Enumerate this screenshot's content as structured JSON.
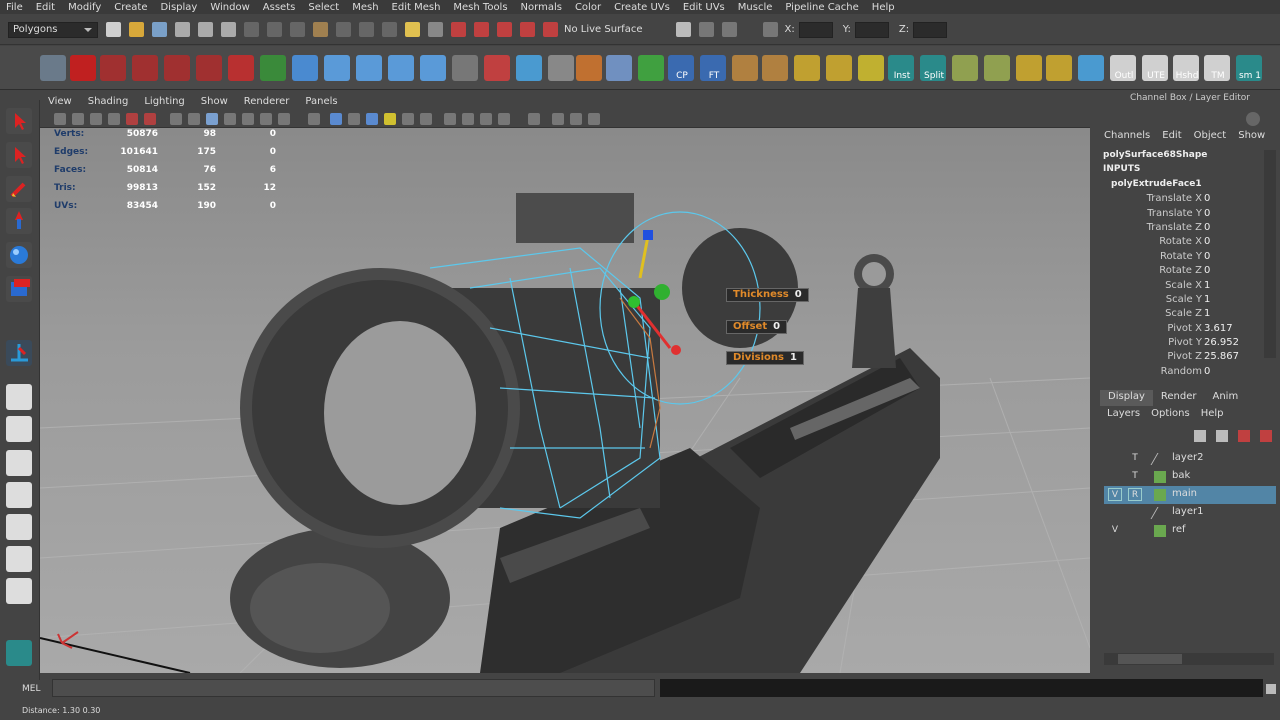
{
  "menubar": [
    "File",
    "Edit",
    "Modify",
    "Create",
    "Display",
    "Window",
    "Assets",
    "Select",
    "Mesh",
    "Edit Mesh",
    "Mesh Tools",
    "Normals",
    "Color",
    "Create UVs",
    "Edit UVs",
    "Muscle",
    "Pipeline Cache",
    "Help"
  ],
  "status": {
    "mode": "Polygons",
    "live_surface": "No Live Surface",
    "x_label": "X:",
    "y_label": "Y:",
    "z_label": "Z:"
  },
  "shelf": {
    "labels": [
      "CP",
      "FT",
      "Inst",
      "Split",
      "Outl",
      "UTE",
      "Hshd",
      "TM",
      "sm 1"
    ]
  },
  "panel_menu": [
    "View",
    "Shading",
    "Lighting",
    "Show",
    "Renderer",
    "Panels"
  ],
  "hud": {
    "rows": [
      {
        "label": "Verts:",
        "a": "50876",
        "b": "98",
        "c": "0"
      },
      {
        "label": "Edges:",
        "a": "101641",
        "b": "175",
        "c": "0"
      },
      {
        "label": "Faces:",
        "a": "50814",
        "b": "76",
        "c": "6"
      },
      {
        "label": "Tris:",
        "a": "99813",
        "b": "152",
        "c": "12"
      },
      {
        "label": "UVs:",
        "a": "83454",
        "b": "190",
        "c": "0"
      }
    ]
  },
  "extrude_hud": {
    "thickness_label": "Thickness",
    "thickness_value": "0",
    "offset_label": "Offset",
    "offset_value": "0",
    "divisions_label": "Divisions",
    "divisions_value": "1"
  },
  "channel_box": {
    "title": "Channel Box / Layer Editor",
    "menu": [
      "Channels",
      "Edit",
      "Object",
      "Show"
    ],
    "shape": "polySurface68Shape",
    "inputs_label": "INPUTS",
    "node": "polyExtrudeFace1",
    "attributes": [
      {
        "name": "Translate X",
        "value": "0"
      },
      {
        "name": "Translate Y",
        "value": "0"
      },
      {
        "name": "Translate Z",
        "value": "0"
      },
      {
        "name": "Rotate X",
        "value": "0"
      },
      {
        "name": "Rotate Y",
        "value": "0"
      },
      {
        "name": "Rotate Z",
        "value": "0"
      },
      {
        "name": "Scale X",
        "value": "1"
      },
      {
        "name": "Scale Y",
        "value": "1"
      },
      {
        "name": "Scale Z",
        "value": "1"
      },
      {
        "name": "Pivot X",
        "value": "3.617"
      },
      {
        "name": "Pivot Y",
        "value": "26.952"
      },
      {
        "name": "Pivot Z",
        "value": "25.867"
      },
      {
        "name": "Random",
        "value": "0"
      }
    ]
  },
  "layer_editor": {
    "tabs": [
      "Display",
      "Render",
      "Anim"
    ],
    "menu": [
      "Layers",
      "Options",
      "Help"
    ],
    "layers": [
      {
        "v": "",
        "t": "T",
        "name": "layer2",
        "color": "",
        "selected": false
      },
      {
        "v": "",
        "t": "T",
        "name": "bak",
        "color": "#6aa84f",
        "selected": false
      },
      {
        "v": "V",
        "t": "R",
        "name": "main",
        "color": "#6aa84f",
        "selected": true
      },
      {
        "v": "",
        "t": "",
        "name": "layer1",
        "color": "",
        "selected": false
      },
      {
        "v": "V",
        "t": "",
        "name": "ref",
        "color": "#6aa84f",
        "selected": false
      }
    ]
  },
  "command_line": {
    "label": "MEL"
  },
  "help_line": {
    "text": "Distance:   1.30      0.30"
  }
}
